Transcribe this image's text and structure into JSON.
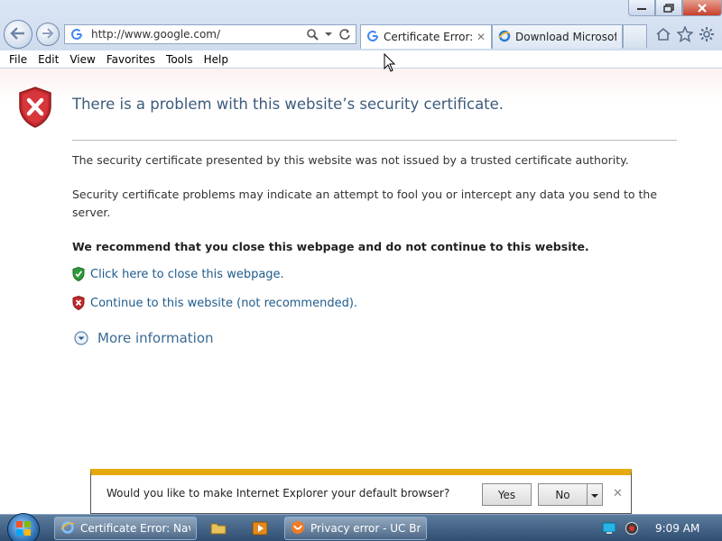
{
  "window": {
    "minimize_icon": "minimize-icon",
    "restore_icon": "restore-icon",
    "close_icon": "close-icon"
  },
  "address_bar": {
    "url": "http://www.google.com/",
    "search_icon": "search-icon",
    "refresh_icon": "refresh-icon"
  },
  "tabs": [
    {
      "label": "Certificate Error: ...",
      "favicon": "google-icon",
      "active": true,
      "close_glyph": "✕"
    },
    {
      "label": "Download Microsof...",
      "favicon": "ie-icon",
      "active": false
    }
  ],
  "toolbar_icons": [
    "home-icon",
    "favorites-star-icon",
    "settings-gear-icon"
  ],
  "menu": [
    "File",
    "Edit",
    "View",
    "Favorites",
    "Tools",
    "Help"
  ],
  "page": {
    "title": "There is a problem with this website’s security certificate.",
    "para1": "The security certificate presented by this website was not issued by a trusted certificate authority.",
    "para2": "Security certificate problems may indicate an attempt to fool you or intercept any data you send to the server.",
    "recommend": "We recommend that you close this webpage and do not continue to this website.",
    "close_link": "Click here to close this webpage.",
    "continue_link": "Continue to this website (not recommended).",
    "more_info": "More information"
  },
  "notification": {
    "message": "Would you like to make Internet Explorer your default browser?",
    "yes_label": "Yes",
    "no_label": "No",
    "close_glyph": "✕"
  },
  "taskbar": {
    "tasks": [
      {
        "label": "Certificate Error: Nav...",
        "icon": "ie-icon"
      },
      {
        "label": "Privacy error - UC Br...",
        "icon": "uc-browser-icon"
      }
    ],
    "pinned": [
      "folder-icon",
      "media-player-icon"
    ],
    "clock": "9:09 AM"
  },
  "colors": {
    "title_blue": "#3d5b7c",
    "link_blue": "#1e5b8c",
    "notify_accent": "#e6a80f",
    "shield_red": "#c0282d",
    "shield_green": "#2e9a3a"
  }
}
